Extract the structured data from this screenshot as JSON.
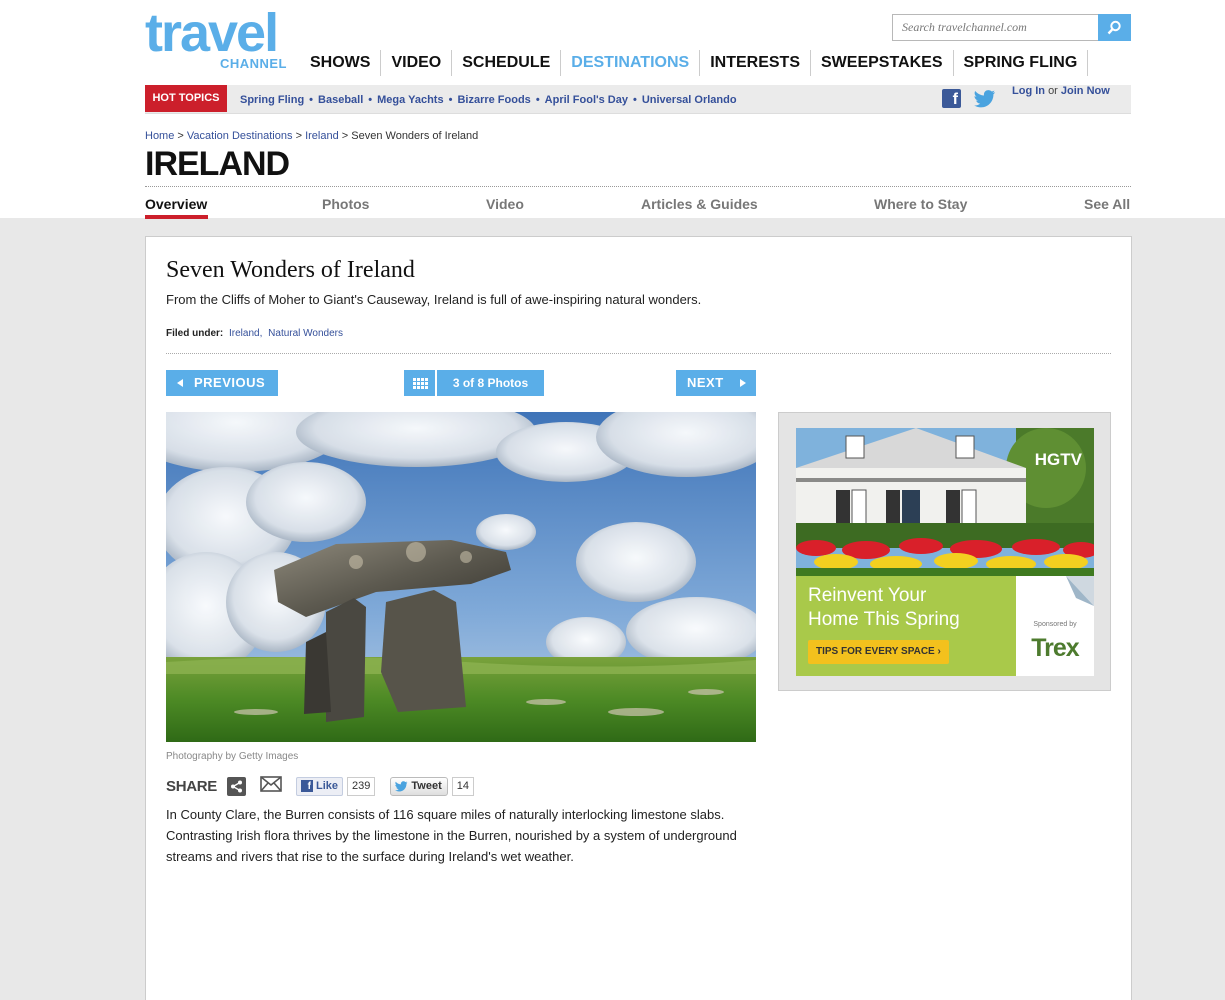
{
  "brand": {
    "logo_main": "travel",
    "logo_sub": "CHANNEL"
  },
  "search": {
    "placeholder": "Search travelchannel.com"
  },
  "main_nav": [
    "SHOWS",
    "VIDEO",
    "SCHEDULE",
    "DESTINATIONS",
    "INTERESTS",
    "SWEEPSTAKES",
    "SPRING FLING"
  ],
  "hot_topics": {
    "label": "HOT TOPICS",
    "links": [
      "Spring Fling",
      "Baseball",
      "Mega Yachts",
      "Bizarre Foods",
      "April Fool's Day",
      "Universal Orlando"
    ],
    "separator": "•"
  },
  "account": {
    "login": "Log In",
    "or": "or",
    "join": "Join Now"
  },
  "breadcrumb": {
    "items": [
      "Home",
      "Vacation Destinations",
      "Ireland",
      "Seven Wonders of Ireland"
    ],
    "separator": ">"
  },
  "page_title": "IRELAND",
  "sub_nav": [
    "Overview",
    "Photos",
    "Video",
    "Articles & Guides",
    "Where to Stay",
    "See All"
  ],
  "article": {
    "title": "Seven Wonders of Ireland",
    "dek": "From the Cliffs of Moher to Giant's Causeway, Ireland is full of awe-inspiring natural wonders.",
    "filed_label": "Filed under:",
    "filed_tags": [
      "Ireland,",
      "Natural Wonders"
    ],
    "prev_label": "PREVIOUS",
    "next_label": "NEXT",
    "photo_count": "3 of 8 Photos",
    "photo_credit": "Photography by Getty Images",
    "share_label": "SHARE",
    "like_label": "Like",
    "like_count": "239",
    "tweet_label": "Tweet",
    "tweet_count": "14",
    "body": "In County Clare, the Burren consists of 116 square miles of naturally interlocking limestone slabs. Contrasting Irish flora thrives by the limestone in the Burren, nourished by a system of underground streams and rivers that rise to the surface during Ireland's wet weather."
  },
  "ad": {
    "network": "HGTV",
    "headline_line1": "Reinvent Your",
    "headline_line2": "Home This Spring",
    "cta": "TIPS FOR EVERY SPACE ›",
    "sponsor_label": "Sponsored by",
    "sponsor": "Trex"
  },
  "colors": {
    "accent": "#5aaee8",
    "hot": "#cc1f2b",
    "link": "#35509a",
    "facebook": "#3b5998"
  }
}
